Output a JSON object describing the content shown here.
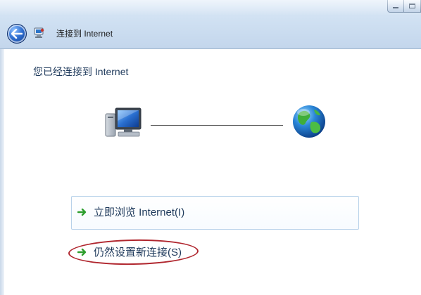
{
  "window": {
    "title": "连接到 Internet",
    "caption_buttons": [
      "minimize",
      "maximize"
    ]
  },
  "icons": {
    "back": "back-arrow-icon",
    "wizard": "network-wizard-icon",
    "computer": "computer-icon",
    "globe": "internet-globe-icon",
    "task_arrow": "green-arrow-icon"
  },
  "main": {
    "heading": "您已经连接到 Internet"
  },
  "tasks": [
    {
      "label": "立即浏览 Internet(I)"
    },
    {
      "label": "仍然设置新连接(S)"
    }
  ],
  "colors": {
    "heading_text": "#1e395b",
    "task_arrow": "#2e9e2e",
    "highlight_ellipse": "#b0262e"
  }
}
